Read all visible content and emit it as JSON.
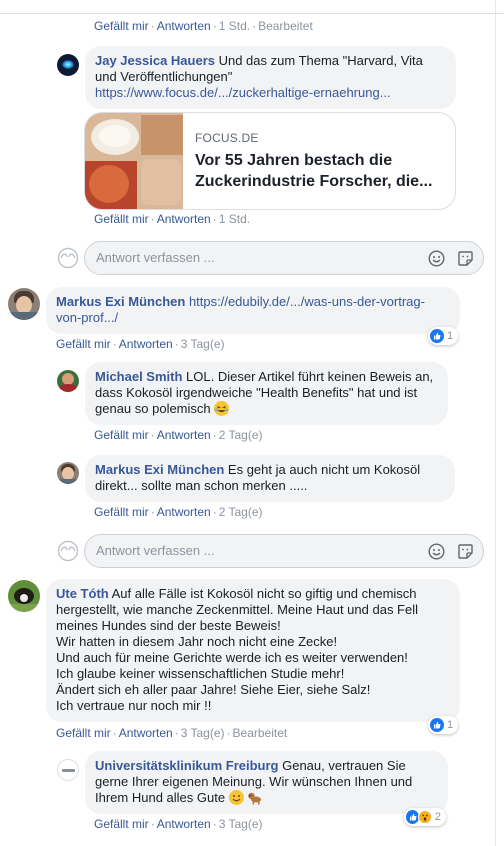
{
  "c1_actions": {
    "like": "Gefällt mir",
    "reply": "Antworten",
    "time": "1 Std.",
    "edited": "Bearbeitet"
  },
  "c2": {
    "author": "Jay Jessica Hauers",
    "text": " Und das zum Thema \"Harvard, Vita und Veröffentlichungen\"",
    "link": "https://www.focus.de/.../zuckerhaltige-ernaehrung...",
    "card": {
      "source": "FOCUS.DE",
      "title": "Vor 55 Jahren bestach die Zuckerindustrie Forscher, die..."
    },
    "actions": {
      "like": "Gefällt mir",
      "reply": "Antworten",
      "time": "1 Std."
    }
  },
  "reply_box_1": {
    "placeholder": "Antwort verfassen ..."
  },
  "c3": {
    "author": "Markus Exi München",
    "link": "https://edubily.de/.../was-uns-der-vortrag-von-prof.../",
    "reactions": "1",
    "actions": {
      "like": "Gefällt mir",
      "reply": "Antworten",
      "time": "3 Tag(e)"
    }
  },
  "c4": {
    "author": "Michael Smith",
    "text": " LOL. Dieser Artikel führt keinen Beweis an, dass Kokosöl irgendweiche \"Health Benefits\" hat und ist genau so polemisch ",
    "actions": {
      "like": "Gefällt mir",
      "reply": "Antworten",
      "time": "2 Tag(e)"
    }
  },
  "c5": {
    "author": "Markus Exi München",
    "text": " Es geht ja auch nicht um Kokosöl direkt... sollte man schon merken .....",
    "actions": {
      "like": "Gefällt mir",
      "reply": "Antworten",
      "time": "2 Tag(e)"
    }
  },
  "reply_box_2": {
    "placeholder": "Antwort verfassen ..."
  },
  "c6": {
    "author": "Ute Tóth",
    "lines": [
      " Auf alle Fälle ist Kokosöl nicht so giftig und chemisch",
      "hergestellt, wie manche Zeckenmittel. Meine Haut und das Fell",
      "meines Hundes sind der beste Beweis!",
      "Wir hatten in diesem Jahr noch nicht eine Zecke!",
      "Und auch für meine Gerichte werde ich es weiter verwenden!",
      "Ich glaube keiner wissenschaftlichen Studie mehr!",
      "Ändert sich eh aller paar Jahre! Siehe Eier, siehe Salz!",
      "Ich vertraue nur noch mir !!"
    ],
    "reactions": "1",
    "actions": {
      "like": "Gefällt mir",
      "reply": "Antworten",
      "time": "3 Tag(e)",
      "edited": "Bearbeitet"
    }
  },
  "c7": {
    "author": "Universitätsklinikum Freiburg",
    "text": " Genau, vertrauen Sie gerne Ihrer eigenen Meinung. Wir wünschen Ihnen und Ihrem Hund alles Gute ",
    "reactions": "2",
    "actions": {
      "like": "Gefällt mir",
      "reply": "Antworten",
      "time": "3 Tag(e)"
    }
  },
  "colors": {
    "link": "#385898",
    "bubble": "#f2f3f5",
    "like": "#1877f2",
    "muted": "#8d949e"
  }
}
